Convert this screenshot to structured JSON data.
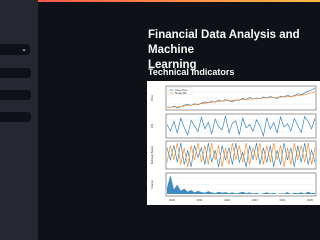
{
  "app": {
    "accent_gradient": [
      "#ff4b4b",
      "#ffbd45"
    ],
    "background": "#0e1117",
    "sidebar_background": "#262730"
  },
  "sidebar": {
    "select": {
      "selected_value": "",
      "icon": "chevron-down-icon"
    },
    "inputs": [
      "",
      "",
      ""
    ]
  },
  "main": {
    "title": "Financial Data Analysis and Machine\nLearning",
    "section_title": "Technical Indicators"
  },
  "chart_data": [
    {
      "type": "line",
      "ylabel": "Price",
      "legend": {
        "placement": "top-left",
        "entries": [
          "Close Price",
          "50-day MA"
        ]
      },
      "series": [
        {
          "name": "Close Price",
          "color": "#1f77b4",
          "values": [
            42,
            41,
            44,
            40,
            43,
            46,
            48,
            45,
            49,
            47,
            50,
            53,
            51,
            55,
            52,
            57,
            54,
            58,
            55,
            53,
            57,
            56,
            60,
            58,
            62,
            59,
            61,
            60,
            63,
            61,
            64,
            62,
            60,
            65,
            63,
            67,
            64,
            66,
            70,
            68,
            72,
            75,
            78,
            82
          ]
        },
        {
          "name": "50-day MA",
          "color": "#ff7f0e",
          "values": [
            42,
            42,
            42,
            42,
            43,
            44,
            45,
            46,
            47,
            48,
            49,
            50,
            51,
            52,
            53,
            54,
            55,
            55,
            56,
            56,
            57,
            57,
            58,
            58,
            59,
            59,
            60,
            60,
            61,
            61,
            62,
            62,
            62,
            63,
            63,
            64,
            64,
            65,
            66,
            67,
            68,
            70,
            72,
            74
          ]
        }
      ],
      "grid": true
    },
    {
      "type": "line",
      "ylabel": "RSI",
      "series": [
        {
          "color": "#1f77b4",
          "values": [
            55,
            40,
            62,
            35,
            70,
            48,
            30,
            65,
            52,
            38,
            72,
            45,
            60,
            33,
            68,
            50,
            42,
            75,
            36,
            58,
            64,
            31,
            70,
            47,
            55,
            39,
            66,
            52,
            28,
            71,
            44,
            60,
            35,
            73,
            49,
            57,
            40,
            69,
            53,
            36,
            74,
            62,
            45,
            70
          ]
        }
      ],
      "grid": true
    },
    {
      "type": "line",
      "ylabel": "Bollinger Bands",
      "series": [
        {
          "color": "#1f77b4",
          "values": [
            3,
            -2,
            4,
            -3,
            5,
            -4,
            2,
            -5,
            4,
            -1,
            3,
            -4,
            5,
            -3,
            2,
            -5,
            4,
            -2,
            3,
            -4,
            5,
            -3,
            1,
            -5,
            4,
            -2,
            5,
            -4,
            3,
            -3,
            4,
            -5,
            2,
            -4,
            5,
            -2,
            3,
            -5,
            4,
            -3,
            5,
            -4,
            2,
            -3
          ]
        },
        {
          "color": "#ff7f0e",
          "values": [
            -3,
            4,
            -2,
            5,
            -4,
            3,
            -5,
            4,
            -2,
            5,
            -3,
            4,
            -4,
            5,
            -2,
            4,
            -5,
            3,
            -4,
            5,
            -2,
            4,
            -3,
            5,
            -4,
            3,
            -2,
            5,
            -4,
            4,
            -3,
            5,
            -2,
            4,
            -5,
            3,
            -4,
            5,
            -2,
            4,
            -3,
            5,
            -4,
            3
          ]
        }
      ],
      "grid": true
    },
    {
      "type": "area",
      "ylabel": "Volume",
      "x_ticks": [
        "2020",
        "2021",
        "2022",
        "2023",
        "2024",
        "2025"
      ],
      "series": [
        {
          "color": "#1f77b4",
          "values": [
            22,
            55,
            18,
            30,
            14,
            20,
            12,
            16,
            10,
            14,
            11,
            9,
            13,
            10,
            8,
            12,
            9,
            11,
            8,
            10,
            7,
            9,
            12,
            8,
            10,
            7,
            9,
            6,
            8,
            10,
            7,
            9,
            6,
            8,
            7,
            11,
            6,
            9,
            8,
            10,
            7,
            12,
            8,
            9
          ]
        }
      ],
      "grid": true
    }
  ]
}
